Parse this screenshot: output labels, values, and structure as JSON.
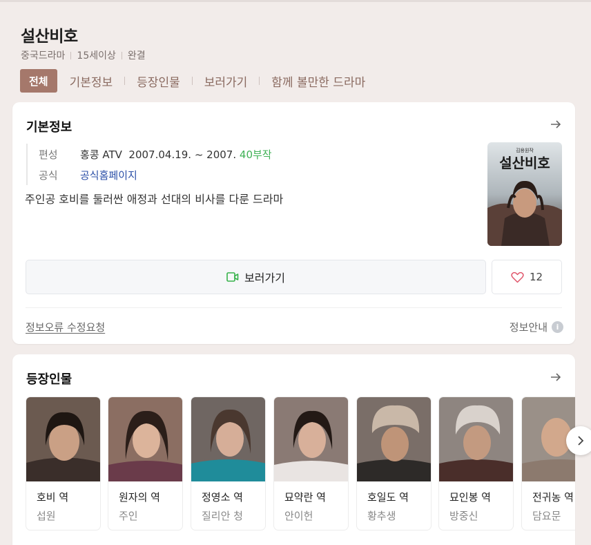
{
  "header": {
    "title": "설산비호",
    "meta": [
      "중국드라마",
      "15세이상",
      "완결"
    ],
    "tabs": {
      "active": "전체",
      "items": [
        "기본정보",
        "등장인물",
        "보러가기",
        "함께 볼만한 드라마"
      ]
    }
  },
  "basic_info": {
    "title": "기본정보",
    "broadcast_label": "편성",
    "broadcast_value": "홍콩 ATV  2007.04.19. ~ 2007.",
    "episodes": "40부작",
    "official_label": "공식",
    "official_value": "공식홈페이지",
    "description": "주인공 호비를 둘러싼 애정과 선대의 비사를 다룬 드라마",
    "poster_title": "설산비호",
    "poster_caption": "김용원작",
    "watch_label": "보러가기",
    "like_count": "12",
    "fix_link": "정보오류 수정요청",
    "info_guide": "정보안내",
    "info_icon": "i",
    "colors": {
      "episodes": "#3fb155",
      "link": "#2b4fa7",
      "tab_active": "#a5786b"
    }
  },
  "characters": {
    "title": "등장인물",
    "items": [
      {
        "role": "호비 역",
        "actor": "섭원"
      },
      {
        "role": "원자의 역",
        "actor": "주인"
      },
      {
        "role": "정영소 역",
        "actor": "질리안 청"
      },
      {
        "role": "묘약란 역",
        "actor": "안이헌"
      },
      {
        "role": "호일도 역",
        "actor": "황추생"
      },
      {
        "role": "묘인봉 역",
        "actor": "방중신"
      },
      {
        "role": "전귀농 역",
        "actor": "담요문"
      }
    ]
  }
}
